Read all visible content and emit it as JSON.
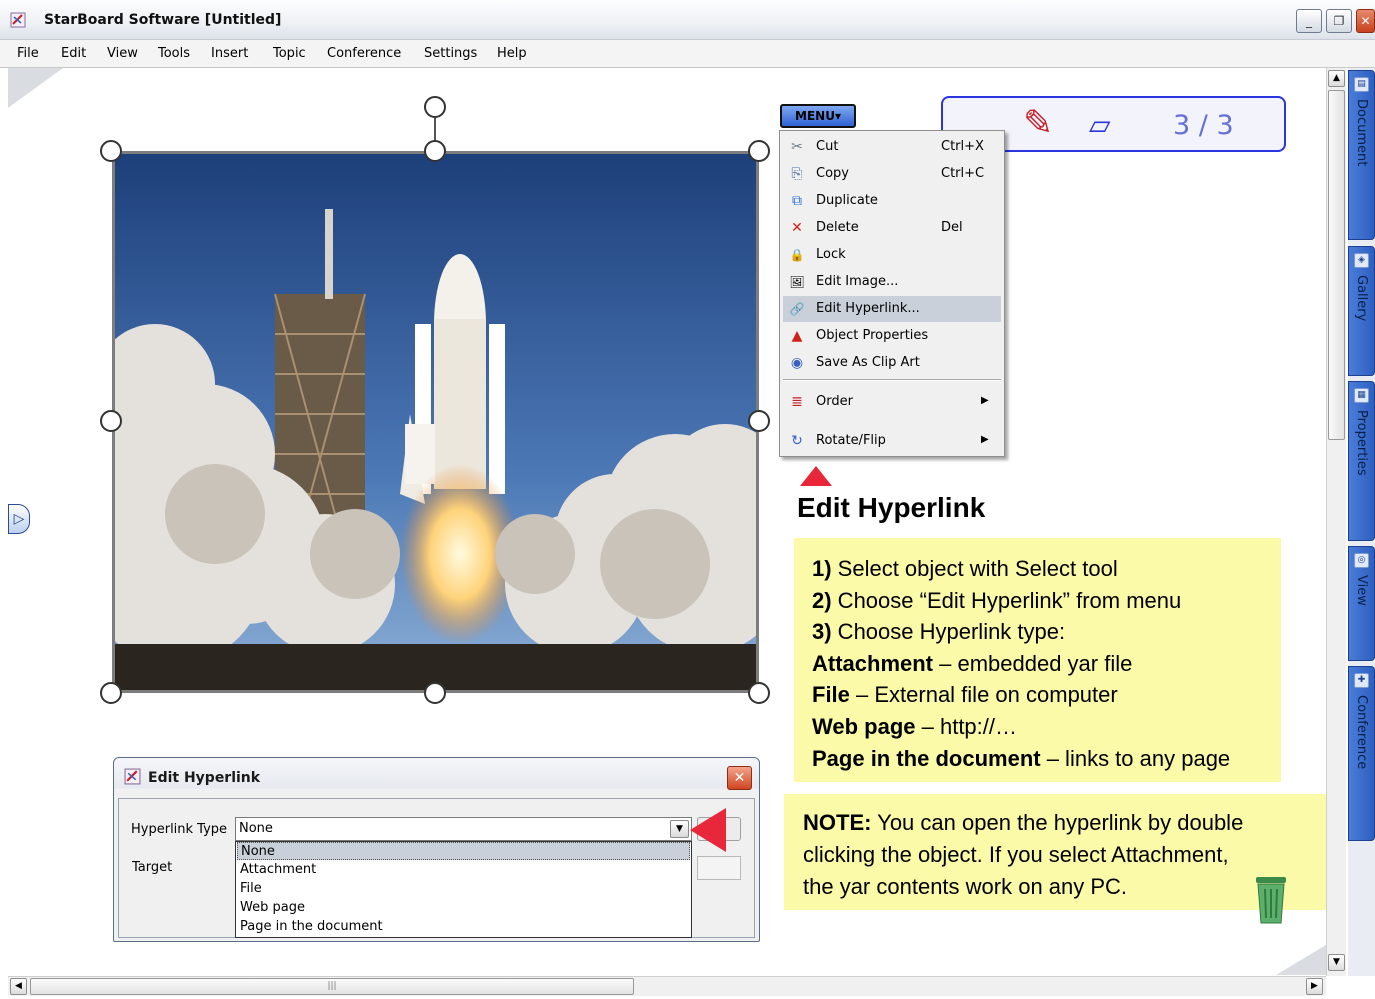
{
  "window": {
    "title": "StarBoard Software [Untitled]",
    "min_glyph": "_",
    "max_glyph": "❐",
    "close_glyph": "✕",
    "icon": "starboard-app-icon"
  },
  "menubar": [
    "File",
    "Edit",
    "View",
    "Tools",
    "Insert",
    "Topic",
    "Conference",
    "Settings",
    "Help"
  ],
  "menu_button": {
    "label": "MENU▾"
  },
  "page_indicator": {
    "current": "3 / 3",
    "pen_icon": "pen-icon",
    "eraser_icon": "eraser-icon"
  },
  "context_menu": {
    "items": [
      {
        "icon": "✂",
        "icon_name": "scissors-icon",
        "label": "Cut",
        "shortcut": "Ctrl+X"
      },
      {
        "icon": "⎘",
        "icon_name": "copy-icon",
        "label": "Copy",
        "shortcut": "Ctrl+C"
      },
      {
        "icon": "⧉",
        "icon_name": "duplicate-icon",
        "label": "Duplicate",
        "shortcut": ""
      },
      {
        "icon": "✕",
        "icon_name": "delete-icon",
        "label": "Delete",
        "shortcut": "Del"
      },
      {
        "icon": "🔒",
        "icon_name": "lock-icon",
        "label": "Lock",
        "shortcut": ""
      },
      {
        "icon": "🖼",
        "icon_name": "edit-image-icon",
        "label": "Edit Image...",
        "shortcut": ""
      },
      {
        "icon": "🔗",
        "icon_name": "hyperlink-icon",
        "label": "Edit Hyperlink...",
        "shortcut": "",
        "highlighted": true
      },
      {
        "icon": "▲",
        "icon_name": "object-properties-icon",
        "label": "Object Properties",
        "shortcut": ""
      },
      {
        "icon": "◉",
        "icon_name": "clip-art-icon",
        "label": "Save As Clip Art",
        "shortcut": ""
      }
    ],
    "submenus": [
      {
        "icon": "≣",
        "icon_name": "order-icon",
        "label": "Order",
        "arrow": "▶"
      },
      {
        "icon": "↻",
        "icon_name": "rotate-flip-icon",
        "label": "Rotate/Flip",
        "arrow": "▶"
      }
    ]
  },
  "heading": "Edit Hyperlink",
  "steps": [
    {
      "bold": "1)",
      "text": " Select object with Select tool"
    },
    {
      "bold": "2)",
      "text": " Choose “Edit Hyperlink” from menu"
    },
    {
      "bold": "3)",
      "text": " Choose Hyperlink type:"
    },
    {
      "bold": "Attachment",
      "text": " – embedded yar file"
    },
    {
      "bold": "File",
      "text": " – External file on computer"
    },
    {
      "bold": "Web page",
      "text": " – http://…"
    },
    {
      "bold": "Page in the document",
      "text": " – links to any page"
    }
  ],
  "note": {
    "bold": "NOTE:",
    "line1": " You can open the hyperlink by double",
    "line2": "clicking the object. If you select Attachment,",
    "line3": "the yar contents work on any PC."
  },
  "dialog": {
    "title": "Edit Hyperlink",
    "close_glyph": "✕",
    "hyperlink_type_label": "Hyperlink Type",
    "hyperlink_type_value": "None",
    "target_label": "Target",
    "browse_label": "...",
    "options": [
      "None",
      "Attachment",
      "File",
      "Web page",
      "Page in the document"
    ],
    "selected_option": "None"
  },
  "side_tabs": [
    "Document",
    "Gallery",
    "Properties",
    "View",
    "Conference"
  ],
  "colors": {
    "accent_blue": "#2f62d4",
    "note_yellow": "#fbfaa8",
    "red_marker": "#e8283a",
    "page_box_border": "#2b35e0"
  }
}
